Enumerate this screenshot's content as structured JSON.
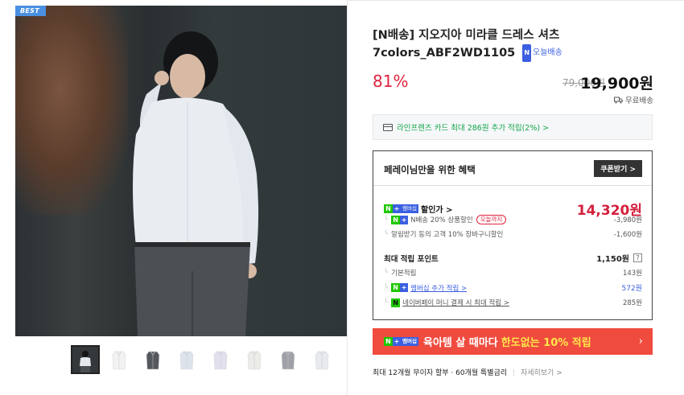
{
  "gallery": {
    "badge": "BEST",
    "thumbnails": [
      {
        "name": "thumb-model",
        "color": "#3a3c3f"
      },
      {
        "name": "thumb-white",
        "color": "#f2f2f2"
      },
      {
        "name": "thumb-charcoal",
        "color": "#55585c"
      },
      {
        "name": "thumb-lightblue",
        "color": "#dde3ec"
      },
      {
        "name": "thumb-lavender",
        "color": "#e3e0ee"
      },
      {
        "name": "thumb-ivory",
        "color": "#ecece8"
      },
      {
        "name": "thumb-gray",
        "color": "#9ea2a8"
      },
      {
        "name": "thumb-pale",
        "color": "#e8eaee"
      }
    ]
  },
  "product": {
    "title": "[N배송] 지오지아 미라클 드레스 셔츠 7colors_ABF2WD1105",
    "today_badge_n": "N",
    "today_badge_label": "오늘배송",
    "discount_rate": "81%",
    "original_price": "79,000원",
    "sale_price": "19,900원",
    "shipping": "무료배송"
  },
  "card_benefit": "라인프렌즈 카드 최대 286원 추가 적립(2%) >",
  "benefits": {
    "title": "페레이님만을 위한 혜택",
    "coupon_button": "쿠폰받기 >",
    "sale_label": "할인가 >",
    "sale_price": "14,320원",
    "discount1_label": "N배송 20% 상품할인",
    "discount1_pill": "오늘까지",
    "discount1_value": "-3,980원",
    "discount2_label": "알림받기 동의 고객 10% 장바구니할인",
    "discount2_value": "-1,600원",
    "points_label": "최대 적립 포인트",
    "points_value": "1,150원",
    "points_help": "?",
    "basic_label": "기본적립",
    "basic_value": "143원",
    "membership_label": "멤버십 추가 적립 >",
    "membership_value": "572원",
    "npay_label": "네이버페이 머니 결제 시 최대 적립 >",
    "npay_value": "285원"
  },
  "badges": {
    "n": "N",
    "plus": "+",
    "membership": "멤버십"
  },
  "promo": {
    "text": "육아템 살 때마다",
    "highlight": "한도없는 10% 적립",
    "arrow": "›"
  },
  "installment": {
    "text": "최대 12개월 무이자 할부 · 60개월 특별금리",
    "sep": "|",
    "detail": "자세히보기 >"
  }
}
